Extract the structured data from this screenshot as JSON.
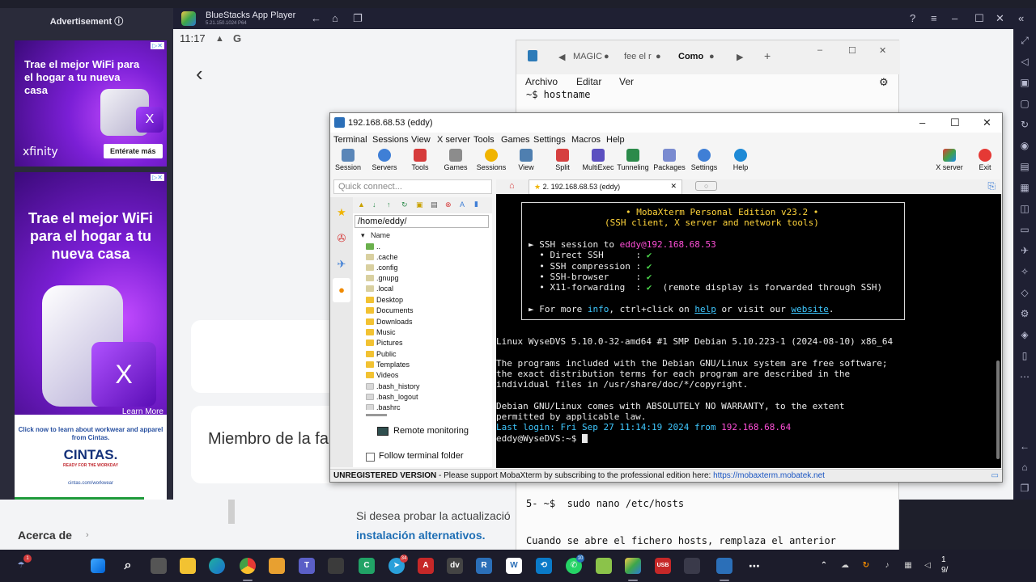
{
  "ads": {
    "title": "Advertisement ⓘ",
    "ad1_headline": "Trae el mejor WiFi para el hogar a tu nueva casa",
    "ad1_brand": "xfinity",
    "ad1_cta": "Entérate más",
    "ad2_headline": "Trae el mejor WiFi para el hogar a tu nueva casa",
    "ad2_learn": "Learn More",
    "ad3_line": "Click now to learn about workwear and apparel from Cintas.",
    "ad3_logo": "CINTAS.",
    "ad3_tag": "READY FOR THE WORKDAY",
    "ad3_url": "cintas.com/workwear"
  },
  "bluestacks": {
    "title": "BlueStacks App Player",
    "version": "5.21.150.1024  P64"
  },
  "android": {
    "time": "11:17",
    "back_glyph": "‹",
    "member_text": "Miembro de la fa"
  },
  "below": {
    "acerca": "Acerca de",
    "si_desea": "Si desea probar la actualizació",
    "instalacion": "instalación alternativos."
  },
  "notepad": {
    "tabs": [
      "MAGIC",
      "fee el r",
      "Como"
    ],
    "menu": [
      "Archivo",
      "Editar",
      "Ver"
    ],
    "line1": "~$ hostname",
    "line2": "5- ~$  sudo nano /etc/hosts",
    "line3": "Cuando se abre el fichero hosts, remplaza el anterior"
  },
  "moba": {
    "title": "192.168.68.53 (eddy)",
    "menu": [
      "Terminal",
      "Sessions",
      "View",
      "X server",
      "Tools",
      "Games",
      "Settings",
      "Macros",
      "Help"
    ],
    "toolbar": [
      "Session",
      "Servers",
      "Tools",
      "Games",
      "Sessions",
      "View",
      "Split",
      "MultiExec",
      "Tunneling",
      "Packages",
      "Settings",
      "Help"
    ],
    "toolbar_right": [
      "X server",
      "Exit"
    ],
    "quick_connect": "Quick connect...",
    "path": "/home/eddy/",
    "col_name": "Name",
    "files": [
      "..",
      ".cache",
      ".config",
      ".gnupg",
      ".local",
      "Desktop",
      "Documents",
      "Downloads",
      "Music",
      "Pictures",
      "Public",
      "Templates",
      "Videos",
      ".bash_history",
      ".bash_logout",
      ".bashrc"
    ],
    "remote_monitoring": "Remote monitoring",
    "follow_folder": "Follow terminal folder",
    "tab_label": "2. 192.168.68.53 (eddy)",
    "term": {
      "banner_title": "• MobaXterm Personal Edition v23.2 •",
      "banner_sub": "(SSH client, X server and network tools)",
      "ssh_prefix": "► SSH session to ",
      "ssh_target": "eddy@192.168.68.53",
      "direct": "  • Direct SSH      : ",
      "compression": "  • SSH compression : ",
      "browser": "  • SSH-browser     : ",
      "x11": "  • X11-forwarding  : ",
      "x11_note": "  (remote display is forwarded through SSH)",
      "check": "✔",
      "more_prefix": "► For more ",
      "info": "info",
      "more_mid": ", ctrl+click on ",
      "help": "help",
      "more_mid2": " or visit our ",
      "website": "website",
      "more_end": ".",
      "uname": "Linux WyseDVS 5.10.0-32-amd64 #1 SMP Debian 5.10.223-1 (2024-08-10) x86_64",
      "p1": "The programs included with the Debian GNU/Linux system are free software;",
      "p2": "the exact distribution terms for each program are described in the",
      "p3": "individual files in /usr/share/doc/*/copyright.",
      "w1": "Debian GNU/Linux comes with ABSOLUTELY NO WARRANTY, to the extent",
      "w2": "permitted by applicable law.",
      "last_prefix": "Last login: Fri Sep 27 11:14:19 2024 from ",
      "last_ip": "192.168.68.64",
      "prompt": "eddy@WyseDVS:~$ "
    },
    "status_bold": "UNREGISTERED VERSION",
    "status_text": "  -  Please support MobaXterm by subscribing to the professional edition here:  ",
    "status_url": "https://mobaxterm.mobatek.net"
  },
  "taskbar": {
    "time": "1",
    "date": "9/"
  }
}
